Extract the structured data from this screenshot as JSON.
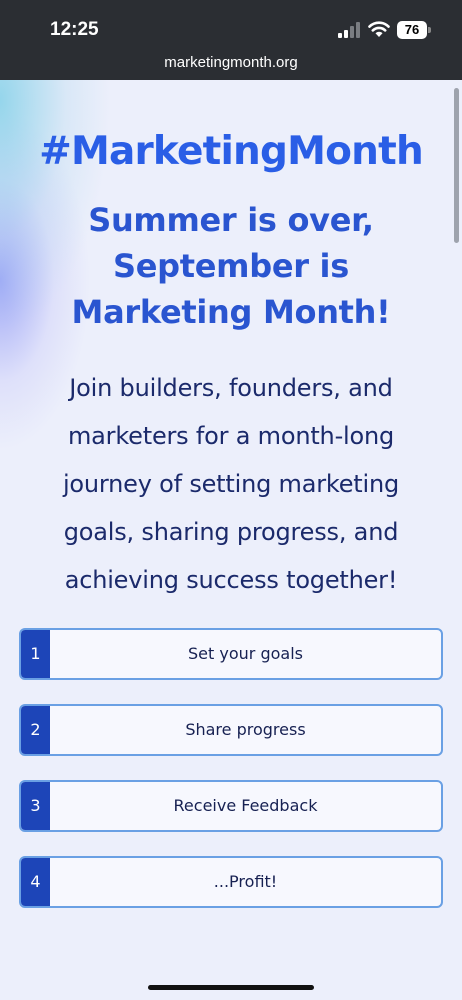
{
  "status_bar": {
    "time": "12:25",
    "battery": "76",
    "url": "marketingmonth.org"
  },
  "hero": {
    "headline": "#MarketingMonth",
    "subheadline": "Summer is over, September is Marketing Month!",
    "description": "Join builders, founders, and marketers for a month-long journey of setting marketing goals, sharing progress, and achieving success together!"
  },
  "steps": [
    {
      "number": "1",
      "label": "Set your goals"
    },
    {
      "number": "2",
      "label": "Share progress"
    },
    {
      "number": "3",
      "label": "Receive Feedback"
    },
    {
      "number": "4",
      "label": "...Profit!"
    }
  ],
  "colors": {
    "accent": "#2a5ee6",
    "step_number_bg": "#1d45b8",
    "step_border": "#6aa0e4",
    "status_bar_bg": "#2b2e33"
  },
  "icons": {
    "signal": "cellular-signal-icon",
    "wifi": "wifi-icon",
    "battery": "battery-icon"
  }
}
